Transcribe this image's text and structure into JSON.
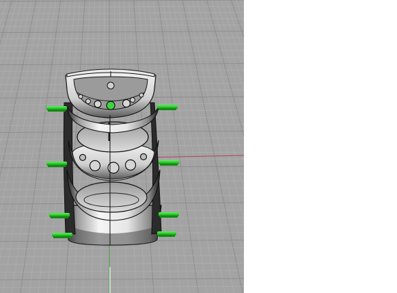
{
  "viewport": {
    "background": "#a3a3a3",
    "grid_minor_color": "#b1b1b1",
    "grid_major_color": "#8c8c8c",
    "axis_x_color": "#b04a4a",
    "axis_y_color": "#3ba53b"
  },
  "model": {
    "pin_color": "#2ecc2e",
    "pin_shade_color": "#138a13",
    "surface_light": "#f4f4f4",
    "surface_mid": "#c9c9c9",
    "surface_dark": "#3a3a3a",
    "edge_color": "#111111"
  },
  "blank_area": {
    "background": "#ffffff"
  }
}
